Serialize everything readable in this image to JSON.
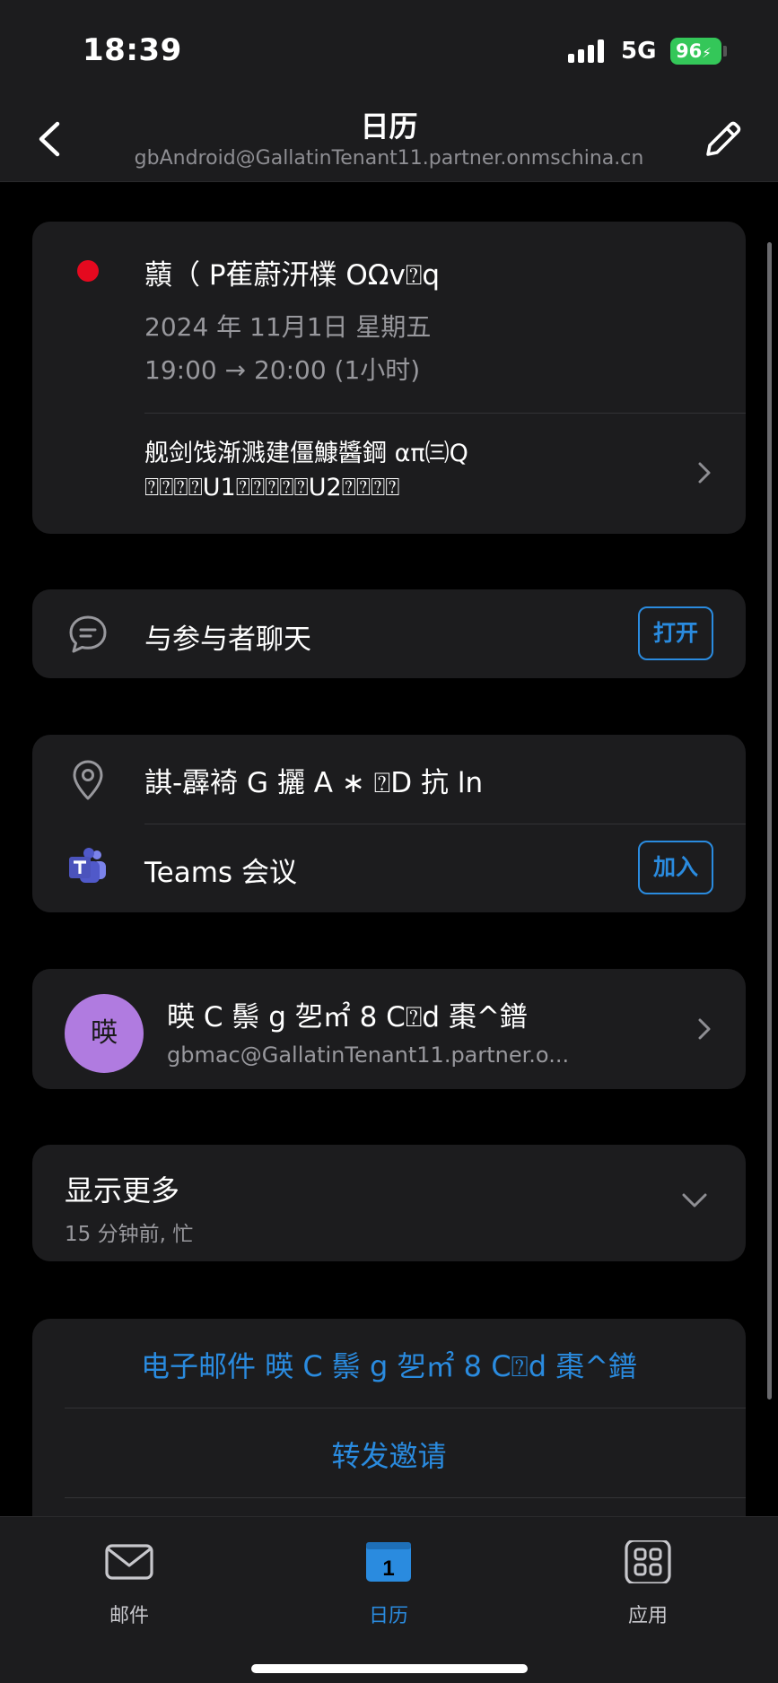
{
  "status_bar": {
    "time": "18:39",
    "network": "5G",
    "battery": "96"
  },
  "header": {
    "title": "日历",
    "subtitle": "gbAndroid@GallatinTenant11.partner.onmschina.cn"
  },
  "event": {
    "title": "蘏（ P萑蔚汧檏 OΩv⍰q",
    "date": "2024 年 11月1日 星期五",
    "time": "19:00 → 20:00 (1小时)",
    "description": "舰剑饯渐溅建僵鱇醬鋼 απ㈢Q\n⍰⍰⍰⍰U1⍰⍰⍰⍰⍰U2⍰⍰⍰⍰",
    "dot_color": "#e5091f"
  },
  "chat": {
    "label": "与参与者聊天",
    "button": "打开"
  },
  "location": {
    "label": "諆-霹裿 G 攦 A ∗ ⍰D 抗 ln"
  },
  "teams": {
    "label": "Teams 会议",
    "button": "加入"
  },
  "organizer": {
    "avatar_text": "暎",
    "name": "暎 C 鬃 g 乫㎡ 8 C⍰d 棗^鐠",
    "email": "gbmac@GallatinTenant11.partner.o..."
  },
  "show_more": {
    "title": "显示更多",
    "subtitle": "15 分钟前, 忙"
  },
  "actions": {
    "email": "电子邮件 暎 C 鬃 g 乫㎡ 8 C⍰d 棗^鐠",
    "forward": "转发邀请"
  },
  "tabbar": {
    "mail": "邮件",
    "calendar": "日历",
    "calendar_day": "1",
    "apps": "应用",
    "active": "calendar",
    "accent_color": "#2a8bdf"
  }
}
